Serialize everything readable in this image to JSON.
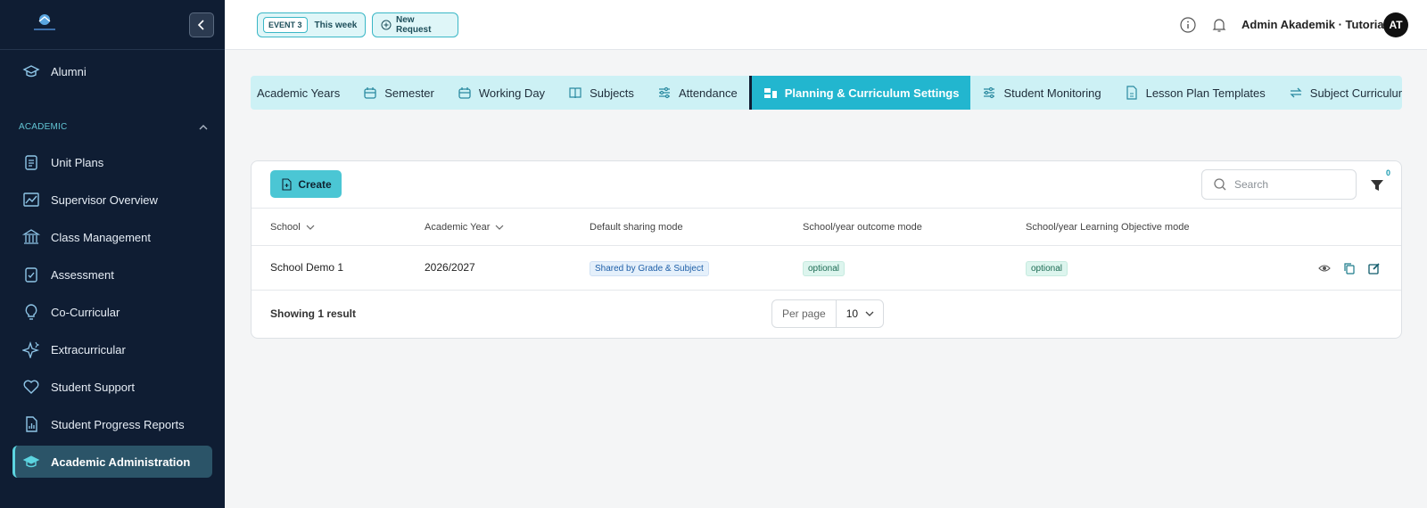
{
  "sidebar": {
    "section_label": "ACADEMIC",
    "items": [
      {
        "label": "Alumni",
        "icon": "graduation-cap-icon"
      },
      {
        "label": "Unit Plans",
        "icon": "clipboard-icon"
      },
      {
        "label": "Supervisor Overview",
        "icon": "chart-icon"
      },
      {
        "label": "Class Management",
        "icon": "building-icon"
      },
      {
        "label": "Assessment",
        "icon": "clipboard-check-icon"
      },
      {
        "label": "Co-Curricular",
        "icon": "lightbulb-icon"
      },
      {
        "label": "Extracurricular",
        "icon": "sparkles-icon"
      },
      {
        "label": "Student Support",
        "icon": "heart-icon"
      },
      {
        "label": "Student Progress Reports",
        "icon": "report-icon"
      },
      {
        "label": "Academic Administration",
        "icon": "graduation-cap-icon"
      }
    ],
    "active_item": "Academic Administration"
  },
  "header": {
    "event_badge": "EVENT 3",
    "event_label": "This week",
    "new_request_label": "New Request",
    "user_name": "Admin Akademik · Tutorial",
    "avatar_initials": "AT"
  },
  "tabs": [
    {
      "label": "Academic Years",
      "icon": ""
    },
    {
      "label": "Semester",
      "icon": "calendar-icon"
    },
    {
      "label": "Working Day",
      "icon": "calendar-icon"
    },
    {
      "label": "Subjects",
      "icon": "book-icon"
    },
    {
      "label": "Attendance",
      "icon": "sliders-icon"
    },
    {
      "label": "Planning & Curriculum Settings",
      "icon": "layout-icon",
      "active": true
    },
    {
      "label": "Student Monitoring",
      "icon": "sliders-icon"
    },
    {
      "label": "Lesson Plan Templates",
      "icon": "file-icon"
    },
    {
      "label": "Subject Curriculum Mappi",
      "icon": "arrows-icon"
    }
  ],
  "toolbar": {
    "create_label": "Create",
    "search_placeholder": "Search",
    "filter_count": "0"
  },
  "table": {
    "columns": [
      "School",
      "Academic Year",
      "Default sharing mode",
      "School/year outcome mode",
      "School/year Learning Objective mode"
    ],
    "rows": [
      {
        "school": "School Demo 1",
        "academic_year": "2026/2027",
        "sharing_mode": "Shared by Grade & Subject",
        "outcome_mode": "optional",
        "lo_mode": "optional"
      }
    ]
  },
  "footer": {
    "result_text": "Showing 1 result",
    "per_page_label": "Per page",
    "per_page_value": "10"
  },
  "colors": {
    "sidebar_bg": "#0f1d33",
    "accent": "#22b6cf",
    "tab_bar_bg": "#cdf1f5"
  }
}
